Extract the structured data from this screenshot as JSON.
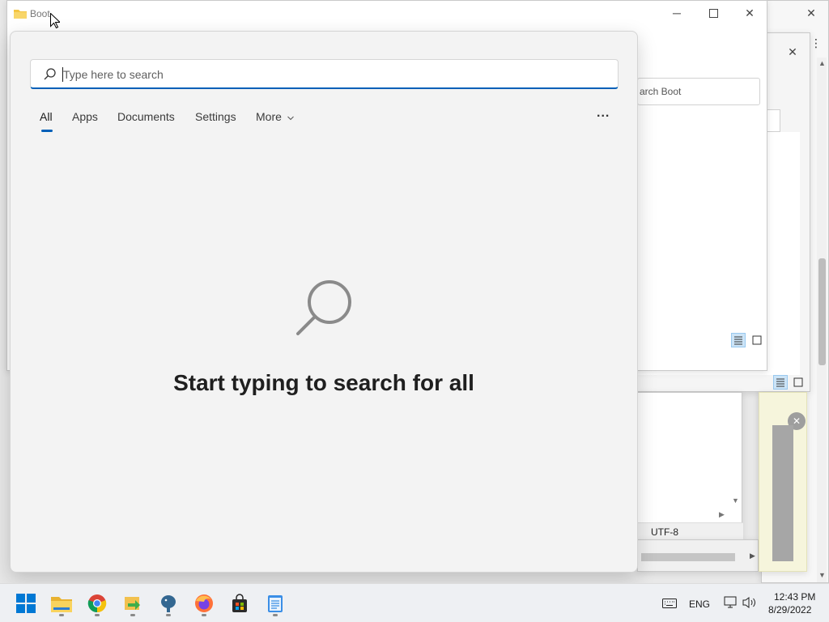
{
  "background_window": {
    "title": "Boot",
    "search_placeholder": "arch Boot",
    "status_encoding": "UTF-8"
  },
  "search": {
    "placeholder": "Type here to search",
    "tabs": [
      {
        "label": "All",
        "active": true
      },
      {
        "label": "Apps"
      },
      {
        "label": "Documents"
      },
      {
        "label": "Settings"
      },
      {
        "label": "More"
      }
    ],
    "more_options": "...",
    "empty_state_title": "Start typing to search for all",
    "accent_color": "#005fb8"
  },
  "taskbar": {
    "apps": [
      {
        "name": "start",
        "icon": "windows-logo-icon"
      },
      {
        "name": "file-explorer",
        "icon": "folder-icon"
      },
      {
        "name": "chrome",
        "icon": "chrome-icon"
      },
      {
        "name": "app-arrow",
        "icon": "green-arrow-icon"
      },
      {
        "name": "postgresql",
        "icon": "elephant-icon"
      },
      {
        "name": "firefox",
        "icon": "firefox-icon"
      },
      {
        "name": "store",
        "icon": "store-bag-icon"
      },
      {
        "name": "notepad",
        "icon": "notepad-icon"
      }
    ],
    "tray": {
      "language": "ENG",
      "time": "12:43 PM",
      "date": "8/29/2022"
    }
  }
}
